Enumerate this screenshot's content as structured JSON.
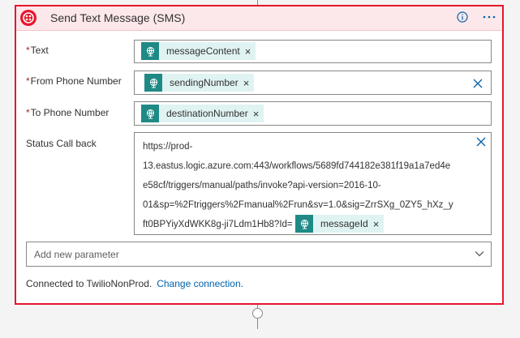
{
  "action": {
    "title": "Send Text Message (SMS)",
    "brand_color": "#e8152d",
    "header_bg": "#fce8ea",
    "icons": [
      "twilio-logo-icon",
      "info-icon",
      "more-options-icon"
    ]
  },
  "fields": {
    "text": {
      "required_mark": "*",
      "label": "Text",
      "token": "messageContent"
    },
    "from_number": {
      "required_mark": "*",
      "label": "From Phone Number",
      "token": "sendingNumber"
    },
    "to_number": {
      "required_mark": "*",
      "label": "To Phone Number",
      "token": "destinationNumber"
    },
    "status_callback": {
      "label": "Status Call back",
      "url_lines": [
        "https://prod-",
        "13.eastus.logic.azure.com:443/workflows/5689fd744182e381f19a1a7ed4e",
        "e58cf/triggers/manual/paths/invoke?api-version=2016-10-",
        "01&sp=%2Ftriggers%2Fmanual%2Frun&sv=1.0&sig=ZrrSXg_0ZY5_hXz_y",
        "ft0BPYiyXdWKK8g-ji7Ldm1Hb8?Id="
      ],
      "token": "messageId"
    }
  },
  "token_remove": "×",
  "token_color": "#1f8a85",
  "token_bg": "#dff3f2",
  "add_parameter": {
    "placeholder": "Add new parameter"
  },
  "footer": {
    "connected_text": "Connected to TwilioNonProd.",
    "change_link": "Change connection.",
    "link_color": "#0062ad"
  }
}
